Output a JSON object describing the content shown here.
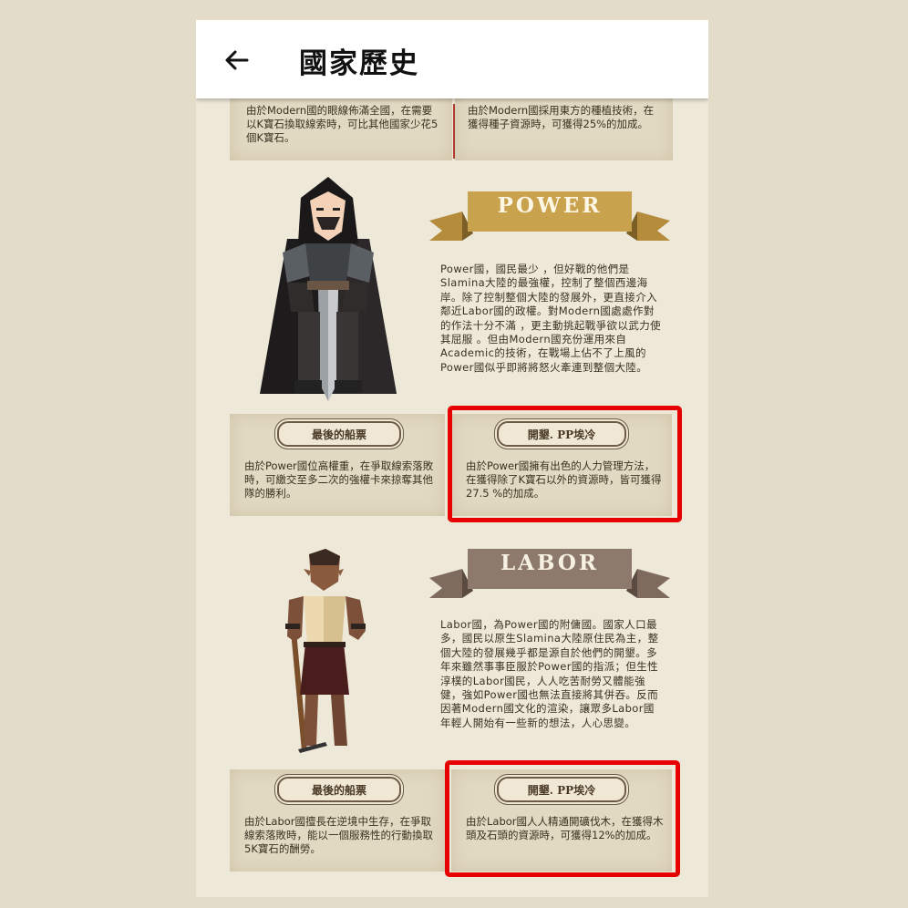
{
  "appbar": {
    "title": "國家歷史",
    "back_icon": "arrow-left-icon"
  },
  "top_cards": {
    "left": "由於Modern國的眼線佈滿全國，在需要以K寶石換取線索時，可比其他國家少花5個K寶石。",
    "right": "由於Modern國採用東方的種植技術，在獲得種子資源時，可獲得25%的加成。"
  },
  "power": {
    "banner": "POWER",
    "description": "Power國，國民最少 ，但好戰的他們是Slamina大陸的最強權，控制了整個西邊海岸。除了控制整個大陸的發展外，更直接介入鄰近Labor國的政權。對Modern國處處作對的作法十分不滿 ，更主動挑起戰爭欲以武力使其屈服 。但由Modern國充份運用來自Academic的技術，在戰場上佔不了上風的Power國似乎即將將怒火牽連到整個大陸。",
    "card_left": {
      "title": "最後的船票",
      "text": "由於Power國位高權重，在爭取線索落敗時，可繳交至多二次的強權卡來掠奪其他隊的勝利。"
    },
    "card_right": {
      "title": "開墾. PP埃冷",
      "text": "由於Power國擁有出色的人力管理方法，在獲得除了K寶石以外的資源時，皆可獲得27.5 %的加成。"
    }
  },
  "labor": {
    "banner": "LABOR",
    "description": "Labor國，為Power國的附傭國。國家人口最多，國民以原生Slamina大陸原住民為主，整個大陸的發展幾乎都是源自於他們的開墾。多年來雖然事事臣服於Power國的指派；但生性淳樸的Labor國民，人人吃苦耐勞又體能強健，強如Power國也無法直接將其併吞。反而因著Modern國文化的渲染，讓眾多Labor國年輕人開始有一些新的想法，人心思變。",
    "card_left": {
      "title": "最後的船票",
      "text": "由於Labor國擅長在逆境中生存，在爭取線索落敗時，能以一個服務性的行動換取5K寶石的酬勞。"
    },
    "card_right": {
      "title": "開墾. PP埃冷",
      "text": "由於Labor國人人精通開礦伐木，在獲得木頭及石頭的資源時，可獲得12%的加成。"
    }
  },
  "colors": {
    "power_banner": "#c9a24e",
    "labor_banner": "#8e7a6c",
    "highlight": "#e60000"
  }
}
